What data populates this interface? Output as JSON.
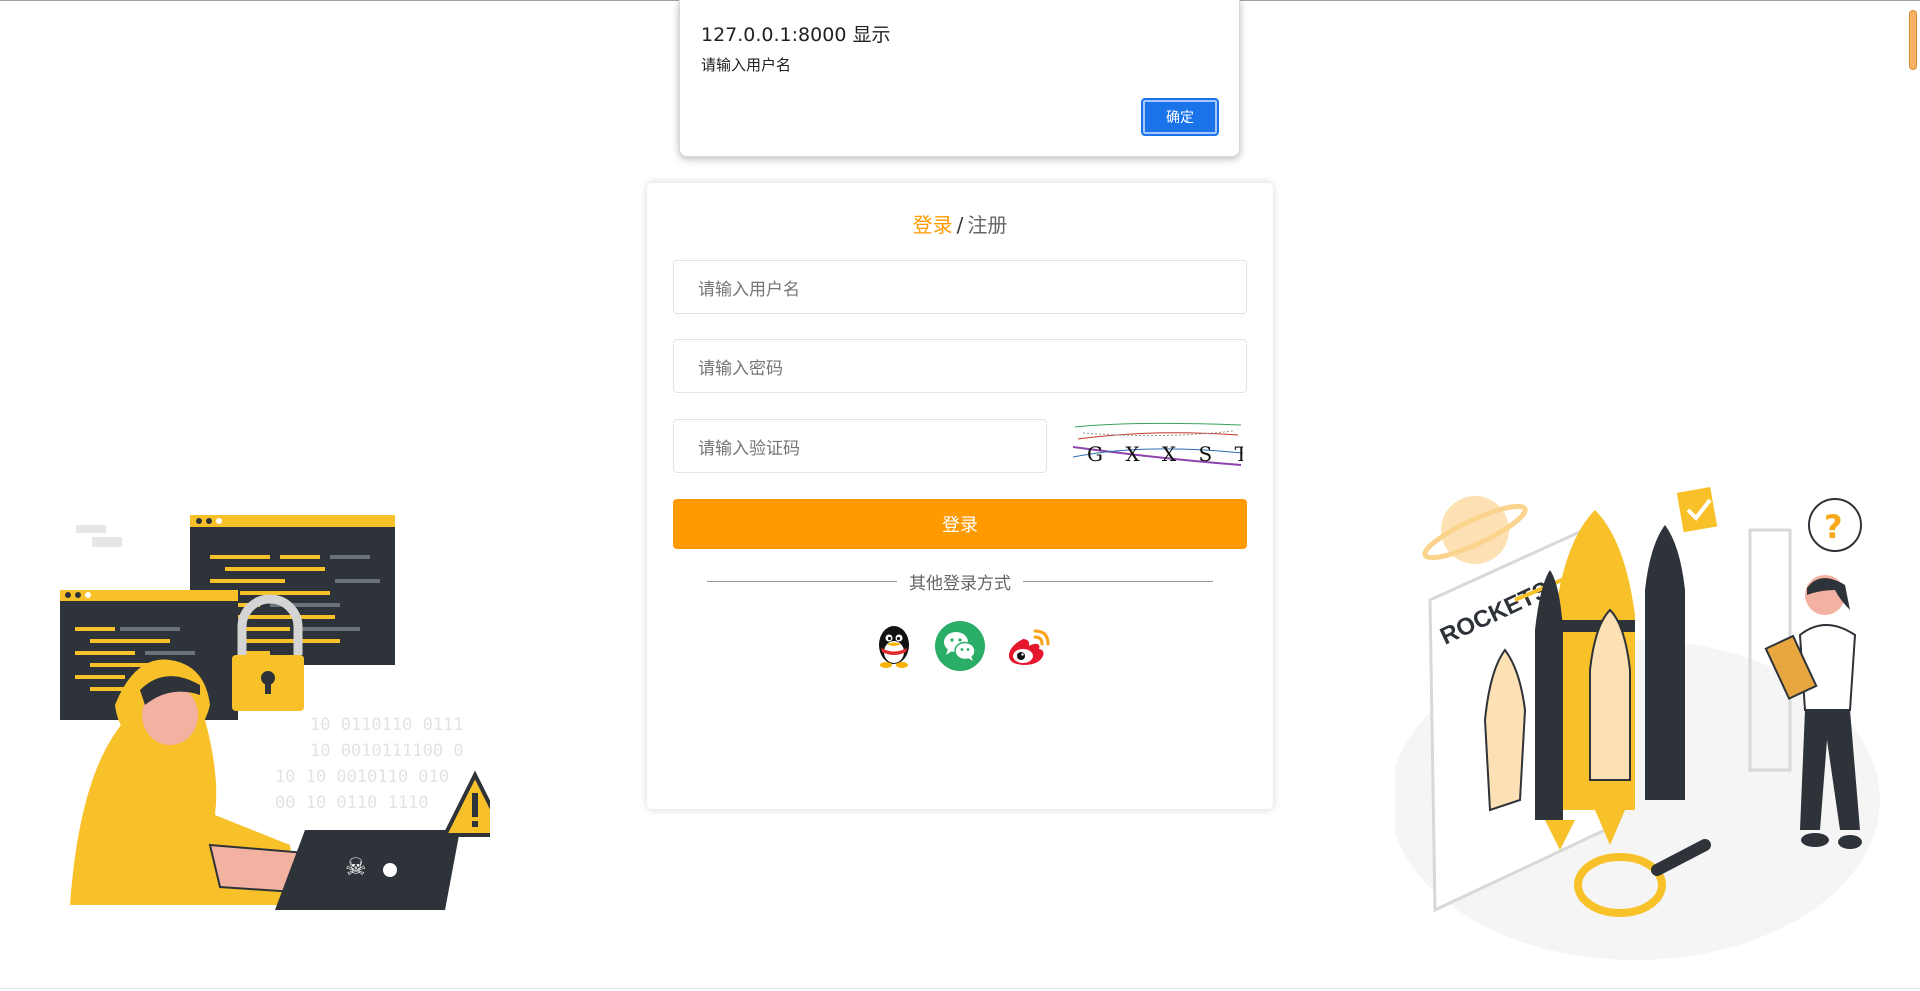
{
  "alert": {
    "title": "127.0.0.1:8000 显示",
    "message": "请输入用户名",
    "ok_label": "确定"
  },
  "login": {
    "tab_login": "登录",
    "tab_separator": "/",
    "tab_register": "注册",
    "username_placeholder": "请输入用户名",
    "password_placeholder": "请输入密码",
    "captcha_placeholder": "请输入验证码",
    "captcha_text": "G X X S T",
    "submit_label": "登录",
    "other_methods_label": "其他登录方式"
  },
  "social": [
    {
      "name": "QQ",
      "icon": "qq-icon"
    },
    {
      "name": "WeChat",
      "icon": "wechat-icon"
    },
    {
      "name": "Weibo",
      "icon": "weibo-icon"
    }
  ],
  "illustrations": {
    "left_binary": [
      "10 0110110 0111",
      "10 0010111100 0",
      "10 10 0010110 010",
      "00 10 0110 1110"
    ],
    "right_label": "ROCKETS"
  },
  "colors": {
    "accent": "#ff9a00",
    "dialog_button": "#1a73e8",
    "wechat": "#2aae67",
    "weibo": "#e6162d",
    "illustration_yellow": "#f8c12a",
    "illustration_dark": "#2d3339"
  }
}
